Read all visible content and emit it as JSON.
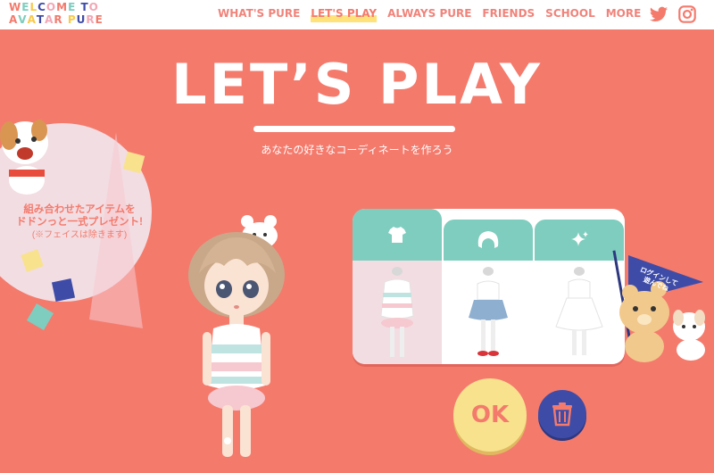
{
  "header": {
    "logo_line1": "WELCOME TO",
    "logo_line2": "AVATAR PURE",
    "nav": [
      {
        "label": "WHAT'S PURE",
        "active": false
      },
      {
        "label": "LET'S PLAY",
        "active": true
      },
      {
        "label": "ALWAYS PURE",
        "active": false
      },
      {
        "label": "FRIENDS",
        "active": false
      },
      {
        "label": "SCHOOL",
        "active": false
      },
      {
        "label": "MORE",
        "active": false
      }
    ],
    "social": [
      {
        "icon": "twitter-icon"
      },
      {
        "icon": "instagram-icon"
      }
    ]
  },
  "hero": {
    "title": "LET’S PLAY",
    "subtitle": "あなたの好きなコーディネートを作ろう"
  },
  "promo": {
    "line1": "組み合わせたアイテムを",
    "line2": "ドドンっと一式プレゼント!",
    "note": "(※フェイスは除きます)"
  },
  "item_panel": {
    "tabs": [
      {
        "icon": "tshirt-icon",
        "selected": true
      },
      {
        "icon": "hair-icon",
        "selected": false
      },
      {
        "icon": "sparkle-icon",
        "selected": false
      }
    ],
    "items": [
      {
        "name": "striped-dress-outfit",
        "selected": true
      },
      {
        "name": "blue-skirt-outfit",
        "selected": false
      },
      {
        "name": "white-dress-outfit",
        "selected": false
      }
    ]
  },
  "buttons": {
    "ok_label": "OK",
    "trash_icon": "trash-icon"
  },
  "login_flag": {
    "line1": "ログインして",
    "line2": "遊んでね"
  },
  "colors": {
    "background": "#F47A6C",
    "accent_mint": "#7ECDBE",
    "accent_yellow": "#F8E28E",
    "accent_navy": "#3E4CA8",
    "nav_text": "#F0837A"
  }
}
